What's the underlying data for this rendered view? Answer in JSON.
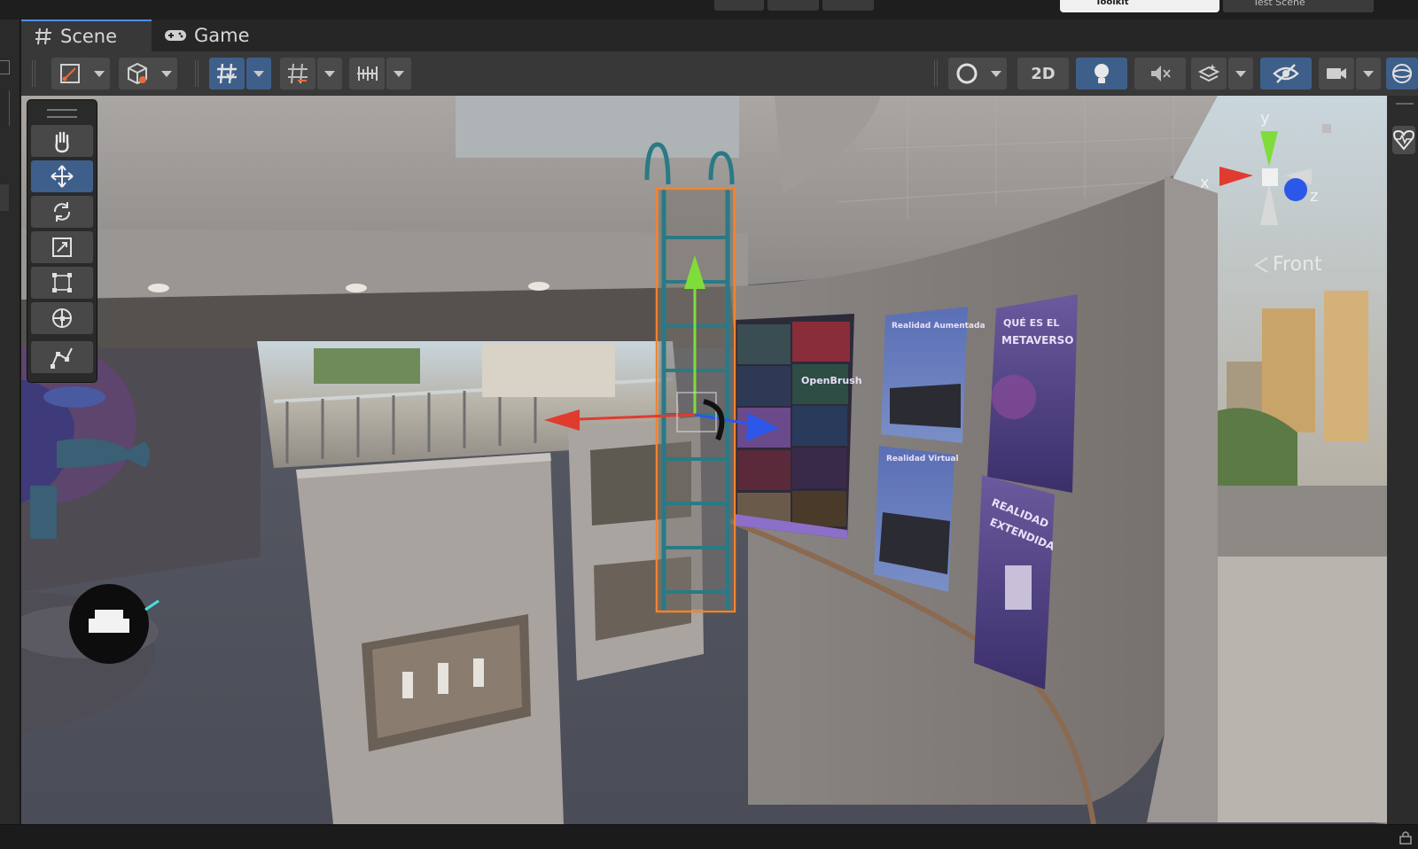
{
  "tabs": {
    "scene": "Scene",
    "game": "Game"
  },
  "topbar": {
    "cloud_label": "Toolkit",
    "test_scene": "Test Scene"
  },
  "toolbar": {
    "mode_2d": "2D"
  },
  "gizmo": {
    "x": "x",
    "y": "y",
    "z": "z",
    "view": "Front"
  },
  "posters": {
    "metaverso_title1": "QUÉ ES EL",
    "metaverso_title2": "METAVERSO",
    "aumentada": "Realidad Aumentada",
    "virtual": "Realidad Virtual",
    "extendida1": "REALIDAD",
    "extendida2": "EXTENDIDA",
    "openbrush": "OpenBrush"
  },
  "colors": {
    "accent": "#3e5f8a",
    "selection": "#f0842e",
    "axis_x": "#e03b2f",
    "axis_y": "#7fdc3a",
    "axis_z": "#2d57e8"
  },
  "icons": {
    "scene_tab": "hash-grid-icon",
    "game_tab": "gamepad-icon",
    "view": "hand-icon",
    "move": "move-arrows-icon",
    "rotate": "rotate-icon",
    "scale": "scale-icon",
    "rect": "rect-transform-icon",
    "transform": "transform-icon",
    "custom": "custom-tool-icon"
  }
}
